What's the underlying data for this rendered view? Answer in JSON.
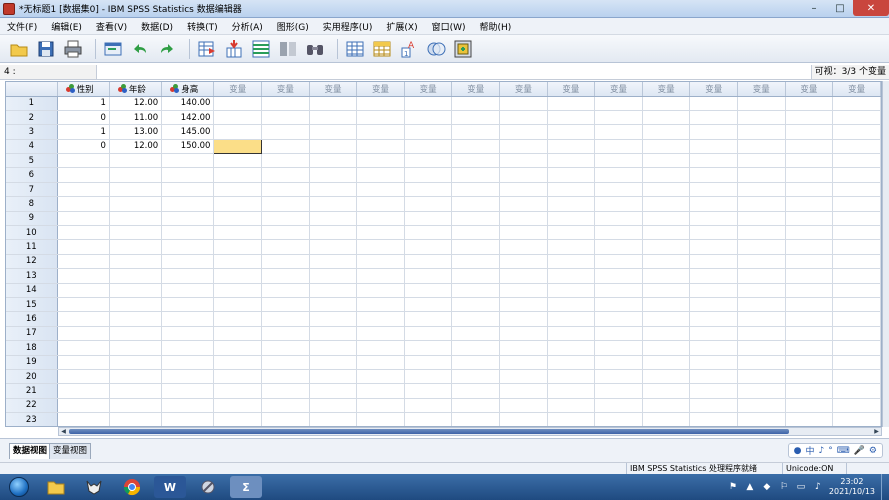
{
  "window": {
    "title": "*无标题1 [数据集0] - IBM SPSS Statistics 数据编辑器",
    "min_label": "–",
    "max_label": "□",
    "close_label": "✕"
  },
  "menu": [
    "文件(F)",
    "编辑(E)",
    "查看(V)",
    "数据(D)",
    "转换(T)",
    "分析(A)",
    "图形(G)",
    "实用程序(U)",
    "扩展(X)",
    "窗口(W)",
    "帮助(H)"
  ],
  "toolbar": {
    "icons": [
      "open-icon",
      "save-icon",
      "print-icon",
      "recall-dialog-icon",
      "undo-icon",
      "redo-icon",
      "goto-case-icon",
      "goto-variable-icon",
      "variables-icon",
      "split-file-icon",
      "find-icon",
      "insert-cases-icon",
      "insert-variable-icon",
      "value-labels-icon",
      "use-sets-icon",
      "spell-check-icon"
    ]
  },
  "cellbar": {
    "cell_ref": "4 :",
    "visible_count": "可视：3/3 个变量"
  },
  "grid": {
    "columns": [
      {
        "label": "性别",
        "named": true
      },
      {
        "label": "年龄",
        "named": true
      },
      {
        "label": "身高",
        "named": true
      },
      {
        "label": "变量",
        "named": false
      },
      {
        "label": "变量",
        "named": false
      },
      {
        "label": "变量",
        "named": false
      },
      {
        "label": "变量",
        "named": false
      },
      {
        "label": "变量",
        "named": false
      },
      {
        "label": "变量",
        "named": false
      },
      {
        "label": "变量",
        "named": false
      },
      {
        "label": "变量",
        "named": false
      },
      {
        "label": "变量",
        "named": false
      },
      {
        "label": "变量",
        "named": false
      },
      {
        "label": "变量",
        "named": false
      },
      {
        "label": "变量",
        "named": false
      },
      {
        "label": "变量",
        "named": false
      },
      {
        "label": "变量",
        "named": false
      }
    ],
    "rows": [
      [
        "1",
        "12.00",
        "140.00"
      ],
      [
        "0",
        "11.00",
        "142.00"
      ],
      [
        "1",
        "13.00",
        "145.00"
      ],
      [
        "0",
        "12.00",
        "150.00"
      ]
    ],
    "row_count": 23,
    "selected": {
      "row": 4,
      "col": 4
    }
  },
  "tabs": {
    "data_view": "数据视图",
    "variable_view": "变量视图"
  },
  "ime": [
    "中",
    "♪",
    "°",
    "⌨",
    "🎤",
    "⚙"
  ],
  "status": {
    "processor": "IBM SPSS Statistics 处理程序就绪",
    "unicode": "Unicode:ON"
  },
  "taskbar": {
    "apps": [
      {
        "name": "explorer-app",
        "label": "",
        "color": "#e8c35a"
      },
      {
        "name": "fox-app",
        "label": "",
        "color": "#3a3a3a"
      },
      {
        "name": "chrome-app",
        "label": "",
        "color": "#ffffff"
      },
      {
        "name": "word-app",
        "label": "W",
        "color": "#2b5797"
      },
      {
        "name": "tool-app",
        "label": "",
        "color": "#b0b8c8"
      },
      {
        "name": "spss-app",
        "label": "Σ",
        "color": "#6d8fbf"
      }
    ],
    "time": "23:02",
    "date": "2021/10/13"
  }
}
